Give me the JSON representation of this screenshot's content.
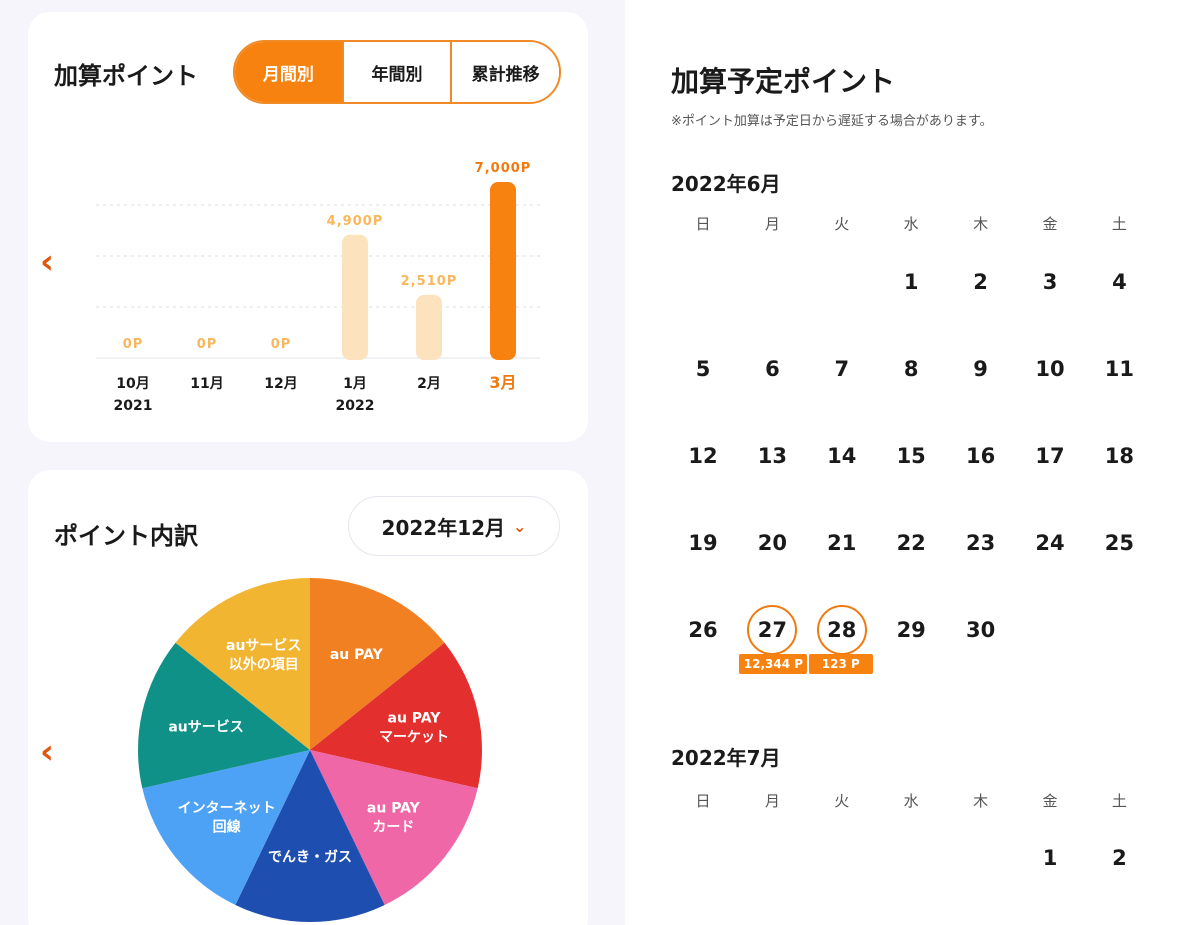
{
  "points_card": {
    "title": "加算ポイント",
    "tabs": [
      "月間別",
      "年間別",
      "累計推移"
    ],
    "active_tab": "月間別",
    "prev_icon": "chevron-left-icon"
  },
  "chart_data": {
    "type": "bar",
    "categories": [
      "10月",
      "11月",
      "12月",
      "1月",
      "2月",
      "3月"
    ],
    "year_labels": [
      "2021",
      "",
      "",
      "2022",
      "",
      ""
    ],
    "values": [
      0,
      0,
      0,
      4900,
      2510,
      7000
    ],
    "value_labels": [
      "0P",
      "0P",
      "0P",
      "4,900P",
      "2,510P",
      "7,000P"
    ],
    "ylim": [
      0,
      7000
    ],
    "grid": true,
    "highlight_index": 5,
    "colors": {
      "normal": "#fde3bd",
      "highlight": "#f7820f",
      "label_normal": "#f7b75e",
      "label_highlight": "#f07a10"
    }
  },
  "breakdown_card": {
    "title": "ポイント内訳",
    "month_select": "2022年12月",
    "prev_icon": "chevron-left-icon",
    "caret_icon": "chevron-down-icon"
  },
  "pie_data": {
    "type": "pie",
    "slices": [
      {
        "label": [
          "au PAY"
        ],
        "value": 1,
        "color": "#f08021"
      },
      {
        "label": [
          "au PAY",
          "マーケット"
        ],
        "value": 1,
        "color": "#e3302f"
      },
      {
        "label": [
          "au PAY",
          "カード"
        ],
        "value": 1,
        "color": "#ef67a7"
      },
      {
        "label": [
          "でんき・ガス"
        ],
        "value": 1,
        "color": "#1e4fb0"
      },
      {
        "label": [
          "インターネット",
          "回線"
        ],
        "value": 1,
        "color": "#4da2f5"
      },
      {
        "label": [
          "auサービス"
        ],
        "value": 1,
        "color": "#109188"
      },
      {
        "label": [
          "auサービス",
          "以外の項目"
        ],
        "value": 1,
        "color": "#f2b532"
      }
    ]
  },
  "schedule": {
    "title": "加算予定ポイント",
    "note": "※ポイント加算は予定日から遅延する場合があります。",
    "weekdays": [
      "日",
      "月",
      "火",
      "水",
      "木",
      "金",
      "土"
    ],
    "months": [
      {
        "label": "2022年6月",
        "start_weekday": 3,
        "days": 30,
        "highlights": [
          {
            "day": 27,
            "badge": "12,344 P"
          },
          {
            "day": 28,
            "badge": "123 P"
          }
        ]
      },
      {
        "label": "2022年7月",
        "start_weekday": 5,
        "days_shown": 2,
        "highlights": []
      }
    ]
  }
}
